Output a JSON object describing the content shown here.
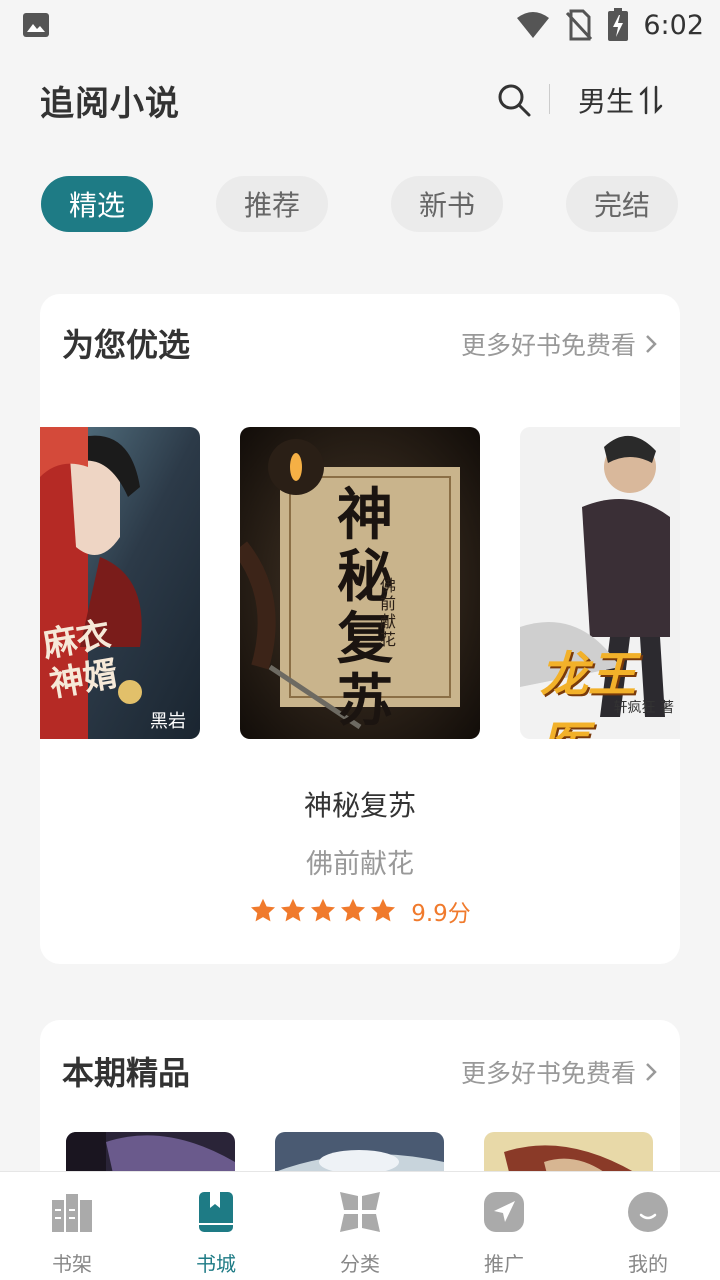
{
  "status_bar": {
    "time": "6:02",
    "icons": [
      "image-notification-icon",
      "wifi-icon",
      "no-sim-icon",
      "battery-charging-icon"
    ]
  },
  "header": {
    "title": "追阅小说",
    "gender_label": "男生",
    "icons": [
      "search-icon",
      "switch-icon"
    ]
  },
  "tabs": [
    {
      "label": "精选",
      "active": true
    },
    {
      "label": "推荐",
      "active": false
    },
    {
      "label": "新书",
      "active": false
    },
    {
      "label": "完结",
      "active": false
    }
  ],
  "featured": {
    "title": "为您优选",
    "more_label": "更多好书免费看",
    "left_cover": {
      "title_text": "麻衣神婿",
      "publisher": "黑岩"
    },
    "center_cover": {
      "title_text": "神秘复苏",
      "author_text": "佛前献花"
    },
    "right_cover": {
      "title_text": "龙王医",
      "author_text": "轩疯狂 著"
    },
    "current_book": {
      "name": "神秘复苏",
      "author": "佛前献花",
      "stars": 5,
      "score_label": "9.9分"
    }
  },
  "quality": {
    "title": "本期精品",
    "more_label": "更多好书免费看"
  },
  "bottom_nav": [
    {
      "label": "书架",
      "icon": "bookshelf-icon",
      "active": false
    },
    {
      "label": "书城",
      "icon": "bookstore-icon",
      "active": true
    },
    {
      "label": "分类",
      "icon": "category-icon",
      "active": false
    },
    {
      "label": "推广",
      "icon": "promote-icon",
      "active": false
    },
    {
      "label": "我的",
      "icon": "profile-icon",
      "active": false
    }
  ],
  "colors": {
    "accent": "#1e7b85",
    "star": "#f07a2c",
    "background": "#f5f5f5"
  }
}
